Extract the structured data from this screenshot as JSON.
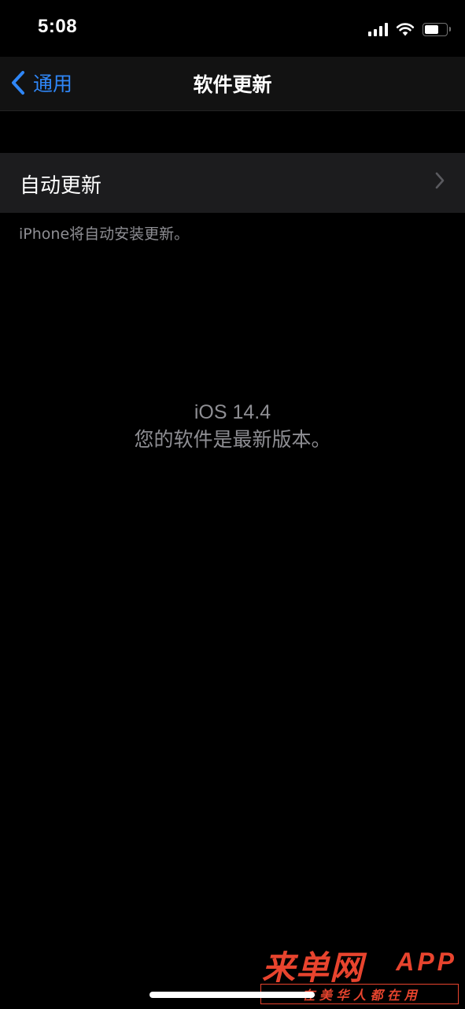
{
  "status_bar": {
    "time": "5:08",
    "signal_icon": "cellular-signal-icon",
    "wifi_icon": "wifi-icon",
    "battery_icon": "battery-icon",
    "battery_level": 0.65
  },
  "nav": {
    "back_label": "通用",
    "back_icon": "chevron-left-icon",
    "title": "软件更新",
    "accent_color": "#2f86f6"
  },
  "settings": {
    "auto_update_label": "自动更新",
    "auto_update_icon": "chevron-right-icon",
    "footer_note": "iPhone将自动安装更新。"
  },
  "version": {
    "name": "iOS 14.4",
    "status": "您的软件是最新版本。"
  },
  "watermark": {
    "logo_text": "来单网",
    "logo_suffix": "APP",
    "slogan": "在 美 华 人 都 在 用",
    "color": "#e8442e"
  }
}
